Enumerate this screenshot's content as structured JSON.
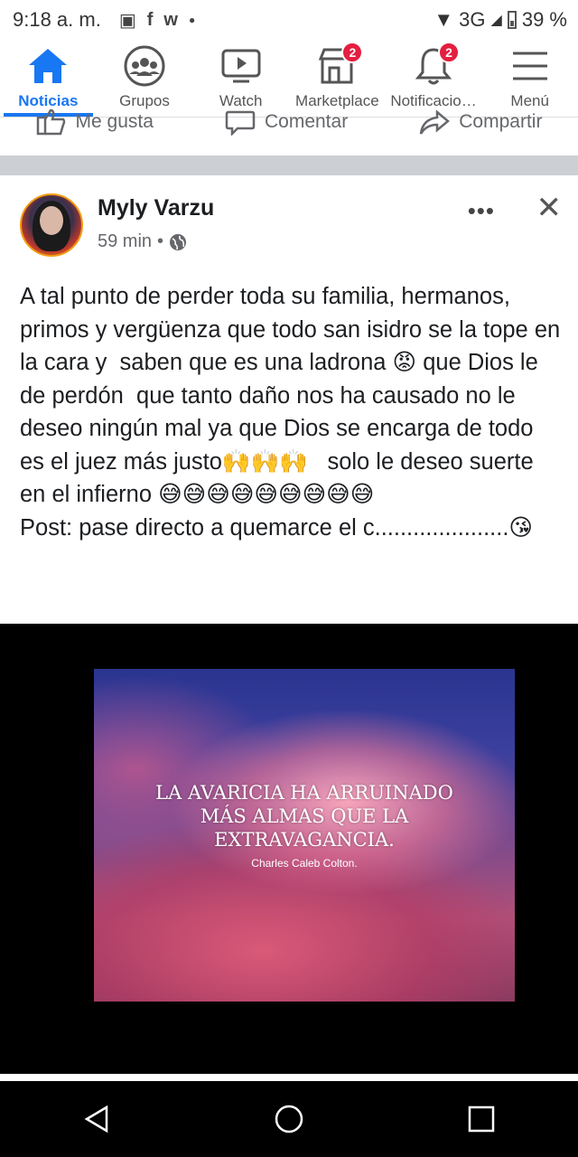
{
  "status_bar": {
    "time": "9:18 a. m.",
    "network": "3G",
    "battery": "39 %"
  },
  "nav": {
    "items": [
      {
        "label": "Noticias",
        "icon": "home-icon",
        "active": true
      },
      {
        "label": "Grupos",
        "icon": "groups-icon"
      },
      {
        "label": "Watch",
        "icon": "watch-icon"
      },
      {
        "label": "Marketplace",
        "icon": "marketplace-icon",
        "badge": "2"
      },
      {
        "label": "Notificacio…",
        "icon": "bell-icon",
        "badge": "2"
      },
      {
        "label": "Menú",
        "icon": "hamburger-icon"
      }
    ]
  },
  "actions": {
    "like": "Me gusta",
    "comment": "Comentar",
    "share": "Compartir"
  },
  "post": {
    "author": "Myly Varzu",
    "time": "59 min",
    "separator": "•",
    "more": "•••",
    "text": "A tal punto de perder toda su familia, hermanos, primos y vergüenza que todo san isidro se la tope en la cara y  saben que es una ladrona 😡 que Dios le de perdón  que tanto daño nos ha causado no le deseo ningún mal ya que Dios se encarga de todo es el juez más justo🙌🙌🙌   solo le deseo suerte en el infierno 😅😅😅😅😅😅😅😅😅\nPost: pase directo a quemarce el c.....................😘",
    "image": {
      "quote_line1": "LA AVARICIA HA ARRUINADO",
      "quote_line2": "MÁS ALMAS QUE LA",
      "quote_line3": "EXTRAVAGANCIA.",
      "quote_author": "Charles Caleb Colton."
    }
  },
  "colors": {
    "accent": "#1877f2",
    "badge": "#e41e3f",
    "divider": "#ccd0d5"
  }
}
